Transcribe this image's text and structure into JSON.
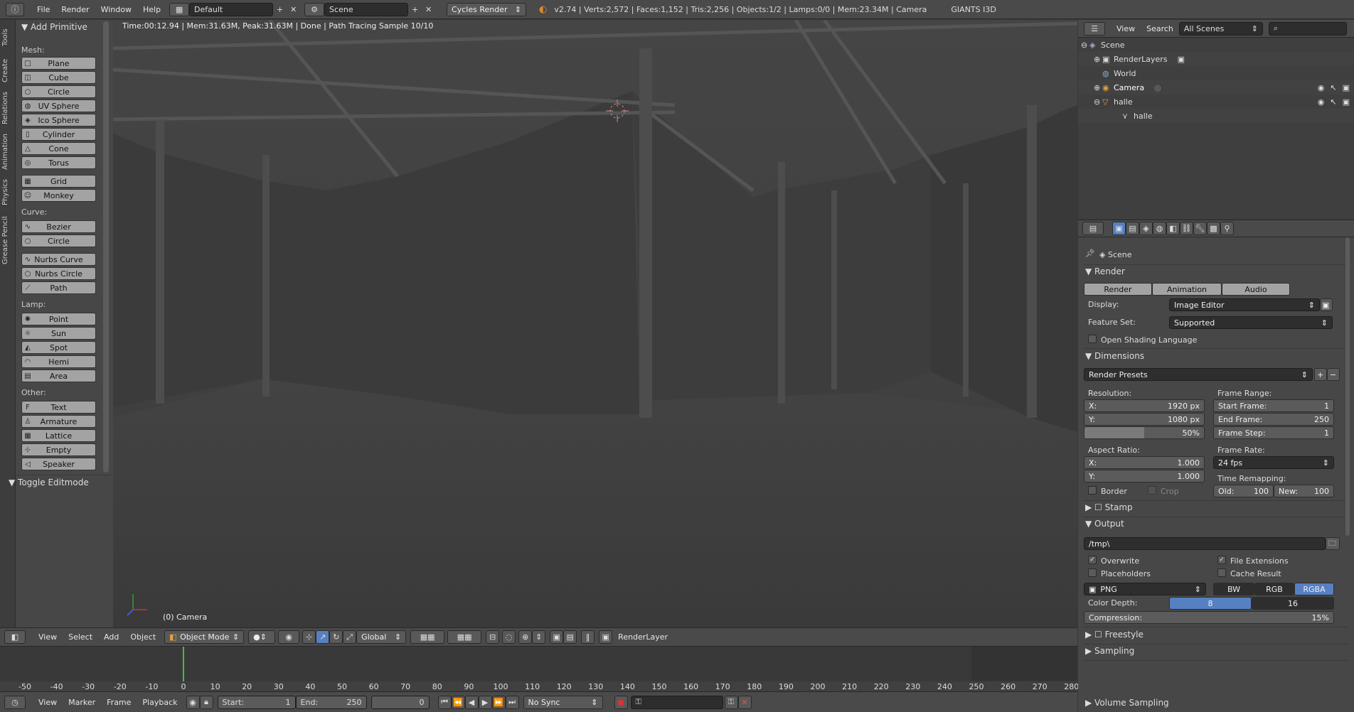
{
  "menu": {
    "file": "File",
    "render": "Render",
    "window": "Window",
    "help": "Help"
  },
  "layout_name": "Default",
  "scene_name": "Scene",
  "engine": "Cycles Render",
  "stats": "v2.74 | Verts:2,572 | Faces:1,152 | Tris:2,256 | Objects:1/2 | Lamps:0/0 | Mem:23.34M | Camera",
  "app_name": "GIANTS I3D",
  "tool_tabs": [
    "Tools",
    "Create",
    "Relations",
    "Animation",
    "Physics",
    "Grease Pencil"
  ],
  "shelf": {
    "panel_title": "Add Primitive",
    "mesh_label": "Mesh:",
    "mesh": [
      "Plane",
      "Cube",
      "Circle",
      "UV Sphere",
      "Ico Sphere",
      "Cylinder",
      "Cone",
      "Torus"
    ],
    "mesh2": [
      "Grid",
      "Monkey"
    ],
    "curve_label": "Curve:",
    "curve": [
      "Bezier",
      "Circle"
    ],
    "curve2": [
      "Nurbs Curve",
      "Nurbs Circle",
      "Path"
    ],
    "lamp_label": "Lamp:",
    "lamp": [
      "Point",
      "Sun",
      "Spot",
      "Hemi",
      "Area"
    ],
    "other_label": "Other:",
    "other": [
      "Text",
      "Armature",
      "Lattice",
      "Empty",
      "Speaker"
    ],
    "toggle": "Toggle Editmode"
  },
  "viewport": {
    "info": "Time:00:12.94 | Mem:31.63M, Peak:31.63M | Done | Path Tracing Sample 10/10",
    "camera": "(0) Camera"
  },
  "vp_header": {
    "view": "View",
    "select": "Select",
    "add": "Add",
    "object": "Object",
    "mode": "Object Mode",
    "orientation": "Global",
    "renderlayer": "RenderLayer"
  },
  "timeline": {
    "ticks": [
      "-50",
      "-40",
      "-30",
      "-20",
      "-10",
      "0",
      "10",
      "20",
      "30",
      "40",
      "50",
      "60",
      "70",
      "80",
      "90",
      "100",
      "110",
      "120",
      "130",
      "140",
      "150",
      "160",
      "170",
      "180",
      "190",
      "200",
      "210",
      "220",
      "230",
      "240",
      "250",
      "260",
      "270",
      "280"
    ],
    "current_frame": 0,
    "view": "View",
    "marker": "Marker",
    "frame": "Frame",
    "playback": "Playback",
    "start_label": "Start:",
    "start": "1",
    "end_label": "End:",
    "end": "250",
    "current": "0",
    "sync": "No Sync"
  },
  "outliner": {
    "view": "View",
    "search": "Search",
    "filter": "All Scenes",
    "rows": [
      "Scene",
      "RenderLayers",
      "World",
      "Camera",
      "halle",
      "halle"
    ]
  },
  "properties": {
    "scene": "Scene",
    "render_section": "Render",
    "render_btn": "Render",
    "animation_btn": "Animation",
    "audio_btn": "Audio",
    "display_label": "Display:",
    "display": "Image Editor",
    "featureset_label": "Feature Set:",
    "featureset": "Supported",
    "osl": "Open Shading Language",
    "dimensions": "Dimensions",
    "presets": "Render Presets",
    "resolution": "Resolution:",
    "res_x_label": "X:",
    "res_x": "1920 px",
    "res_y_label": "Y:",
    "res_y": "1080 px",
    "res_pct": "50%",
    "res_pct_value": 50,
    "frame_range": "Frame Range:",
    "start_frame_label": "Start Frame:",
    "start_frame": "1",
    "end_frame_label": "End Frame:",
    "end_frame": "250",
    "frame_step_label": "Frame Step:",
    "frame_step": "1",
    "aspect": "Aspect Ratio:",
    "asp_x_label": "X:",
    "asp_x": "1.000",
    "asp_y_label": "Y:",
    "asp_y": "1.000",
    "frame_rate": "Frame Rate:",
    "fps": "24 fps",
    "time_remap": "Time Remapping:",
    "old_label": "Old:",
    "old": "100",
    "new_label": "New:",
    "new": "100",
    "border": "Border",
    "crop": "Crop",
    "stamp": "Stamp",
    "output": "Output",
    "path": "/tmp\\",
    "overwrite": "Overwrite",
    "file_ext": "File Extensions",
    "placeholders": "Placeholders",
    "cache": "Cache Result",
    "format": "PNG",
    "bw": "BW",
    "rgb": "RGB",
    "rgba": "RGBA",
    "color_depth": "Color Depth:",
    "depth8": "8",
    "depth16": "16",
    "compression": "Compression:",
    "compression_val": "15%",
    "freestyle": "Freestyle",
    "sampling": "Sampling",
    "volume": "Volume Sampling"
  },
  "colors": {
    "accent": "#5680c2",
    "timeline_cursor": "#40c040"
  }
}
